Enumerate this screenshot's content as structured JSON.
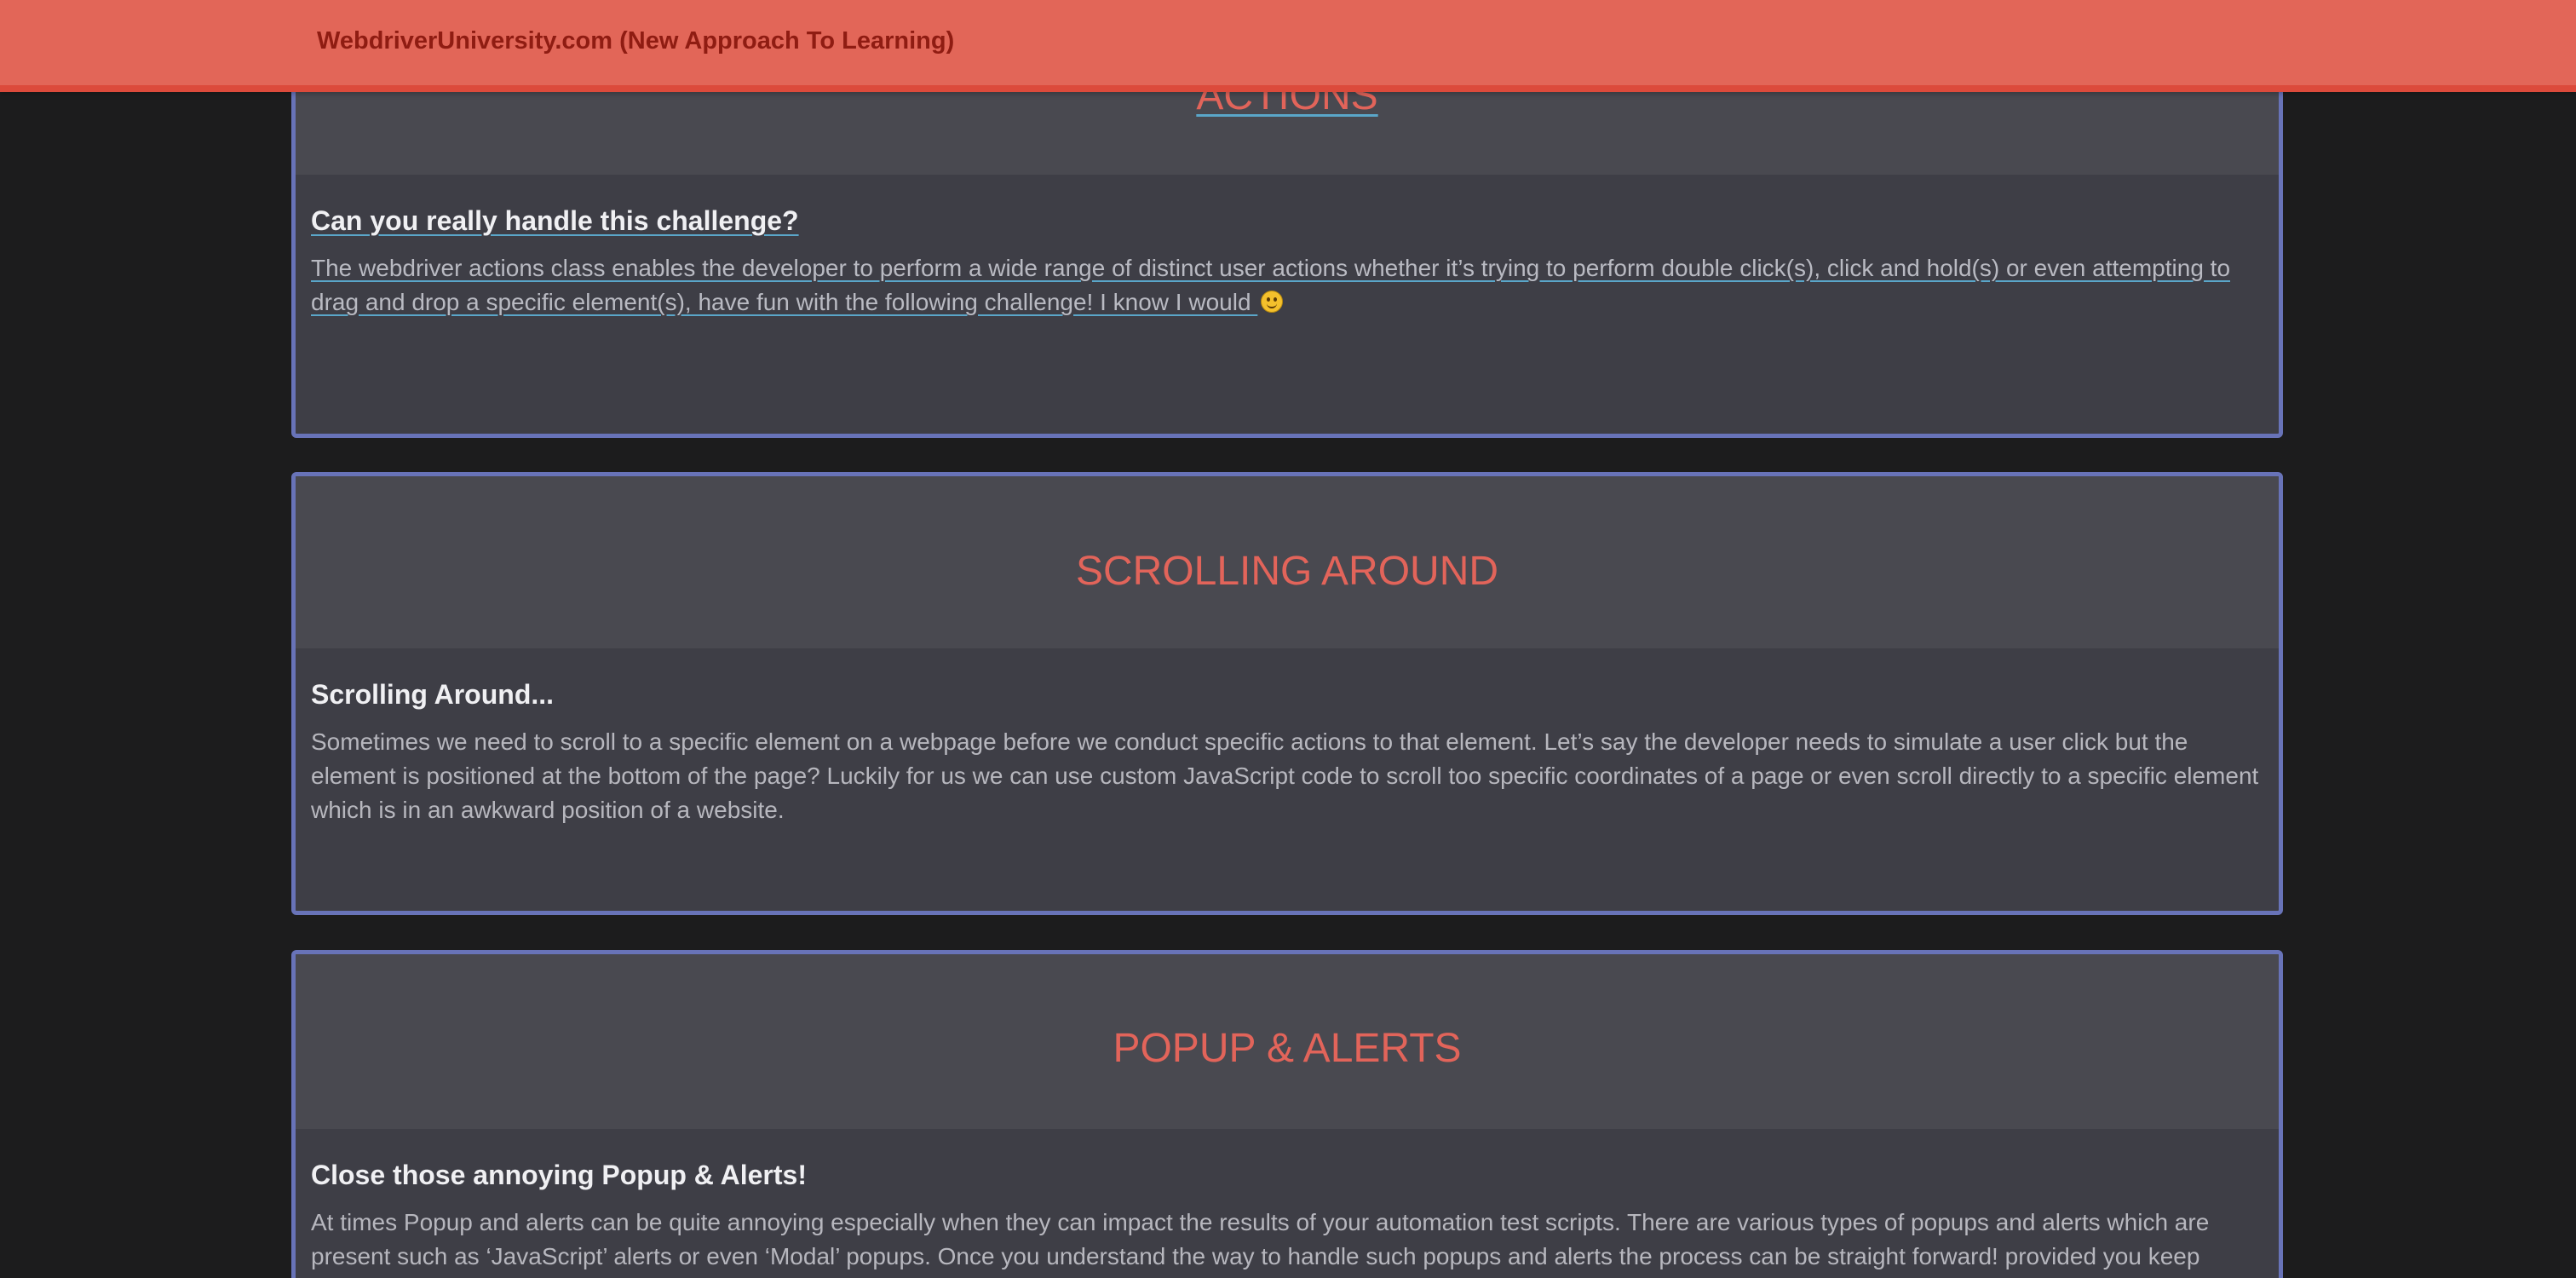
{
  "navbar": {
    "brand": "WebdriverUniversity.com (New Approach To Learning)"
  },
  "cards": [
    {
      "title": "ACTIONS",
      "subtitle": "Can you really handle this challenge?",
      "description": "The webdriver actions class enables the developer to perform a wide range of distinct user actions whether it’s trying to perform double click(s), click and hold(s) or even attempting to drag and drop a specific element(s), have fun with the following challenge! I know I would",
      "emoji": "smiling-face-icon"
    },
    {
      "title": "SCROLLING AROUND",
      "subtitle": "Scrolling Around...",
      "description": "Sometimes we need to scroll to a specific element on a webpage before we conduct specific actions to that element. Let’s say the developer needs to simulate a user click but the element is positioned at the bottom of the page? Luckily for us we can use custom JavaScript code to scroll too specific coordinates of a page or even scroll directly to a specific element which is in an awkward position of a website."
    },
    {
      "title": "POPUP & ALERTS",
      "subtitle": "Close those annoying Popup & Alerts!",
      "description": "At times Popup and alerts can be quite annoying especially when they can impact the results of your automation test scripts. There are various types of popups and alerts which are present such as ‘JavaScript’ alerts or even ‘Modal’ popups. Once you understand the way to handle such popups and alerts the process can be straight forward! provided you keep"
    }
  ],
  "colors": {
    "navbar": "#e26658",
    "brand_text": "#8f1c12",
    "card_border": "#6873b8",
    "card_title": "#e2645a",
    "background": "#1c1c1d"
  }
}
